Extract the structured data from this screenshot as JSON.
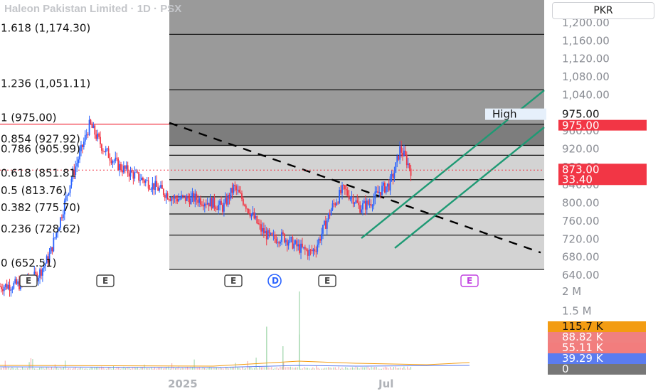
{
  "watermark": "Haleon Pakistan Limited · 1D · PSX",
  "currency": "PKR",
  "colors": {
    "up": "#2962ff",
    "down": "#f23645",
    "channel": "#1e9a74",
    "fib_zone_dark": "#7d7d7d",
    "fib_zone_mid": "#9a9a9a",
    "fib_zone_light": "#d3d3d3"
  },
  "price_tags": {
    "high_label": "High",
    "high_value": "975.00",
    "level_value": "975.00",
    "last_price": "873.00",
    "change": "33.40"
  },
  "volume_tags": [
    "115.7 K",
    "88.82 K",
    "55.11 K",
    "39.29 K",
    "0"
  ],
  "volume_tag_colors": [
    "#f39c12",
    "#f08080",
    "#f27d7d",
    "#5b7cf0",
    "#777777"
  ],
  "events": [
    {
      "label": "E",
      "style": "earnings"
    },
    {
      "label": "E",
      "style": "earnings"
    },
    {
      "label": "E",
      "style": "earnings"
    },
    {
      "label": "D",
      "style": "dividend"
    },
    {
      "label": "E",
      "style": "earnings"
    },
    {
      "label": "E",
      "style": "earnings-upcoming"
    }
  ],
  "chart_data": {
    "type": "candlestick",
    "title": "Haleon Pakistan Limited · 1D · PSX",
    "ylim": [
      640,
      1200
    ],
    "y_ticks": [
      "1,200.00",
      "1,160.00",
      "1,120.00",
      "1,080.00",
      "1,040.00",
      "1,000.00",
      "960.00",
      "920.00",
      "880.00",
      "840.00",
      "800.00",
      "760.00",
      "720.00",
      "680.00",
      "640.00"
    ],
    "x_tick_labels": [
      "2025",
      "Jul"
    ],
    "volume_axis_ticks": [
      "2 M",
      "1.5 M"
    ],
    "fib_levels": [
      {
        "ratio": "1.618",
        "price": 1174.3,
        "label": "1.618 (1,174.30)"
      },
      {
        "ratio": "1.236",
        "price": 1051.11,
        "label": "1.236 (1,051.11)"
      },
      {
        "ratio": "1",
        "price": 975.0,
        "label": "1 (975.00)"
      },
      {
        "ratio": "0.854",
        "price": 927.92,
        "label": "0.854 (927.92)"
      },
      {
        "ratio": "0.786",
        "price": 905.99,
        "label": "0.786 (905.99)"
      },
      {
        "ratio": "0.618",
        "price": 851.81,
        "label": "0.618 (851.81"
      },
      {
        "ratio": "0.5",
        "price": 813.76,
        "label": "0.5 (813.76)"
      },
      {
        "ratio": "0.382",
        "price": 775.7,
        "label": "0.382 (775.70)"
      },
      {
        "ratio": "0.236",
        "price": 728.62,
        "label": "0.236 (728.62)"
      },
      {
        "ratio": "0",
        "price": 652.51,
        "label": "0 (652.51)"
      }
    ],
    "price_path": [
      [
        0,
        615
      ],
      [
        0.04,
        620
      ],
      [
        0.07,
        640
      ],
      [
        0.09,
        680
      ],
      [
        0.11,
        760
      ],
      [
        0.13,
        850
      ],
      [
        0.15,
        920
      ],
      [
        0.165,
        975
      ],
      [
        0.19,
        920
      ],
      [
        0.22,
        880
      ],
      [
        0.25,
        860
      ],
      [
        0.28,
        840
      ],
      [
        0.32,
        810
      ],
      [
        0.36,
        810
      ],
      [
        0.39,
        800
      ],
      [
        0.41,
        790
      ],
      [
        0.43,
        835
      ],
      [
        0.45,
        800
      ],
      [
        0.48,
        740
      ],
      [
        0.5,
        720
      ],
      [
        0.52,
        725
      ],
      [
        0.55,
        700
      ],
      [
        0.57,
        690
      ],
      [
        0.58,
        700
      ],
      [
        0.61,
        790
      ],
      [
        0.63,
        830
      ],
      [
        0.65,
        810
      ],
      [
        0.66,
        790
      ],
      [
        0.68,
        800
      ],
      [
        0.7,
        830
      ],
      [
        0.715,
        840
      ],
      [
        0.725,
        870
      ],
      [
        0.735,
        920
      ],
      [
        0.745,
        900
      ],
      [
        0.755,
        873
      ]
    ],
    "volume_spikes": [
      {
        "x": 0.55,
        "v": 2000000
      },
      {
        "x": 0.55,
        "v": 900000
      },
      {
        "x": 0.49,
        "v": 1100000
      },
      {
        "x": 0.52,
        "v": 600000
      }
    ],
    "last_price": 873.0,
    "high": 975.0
  }
}
